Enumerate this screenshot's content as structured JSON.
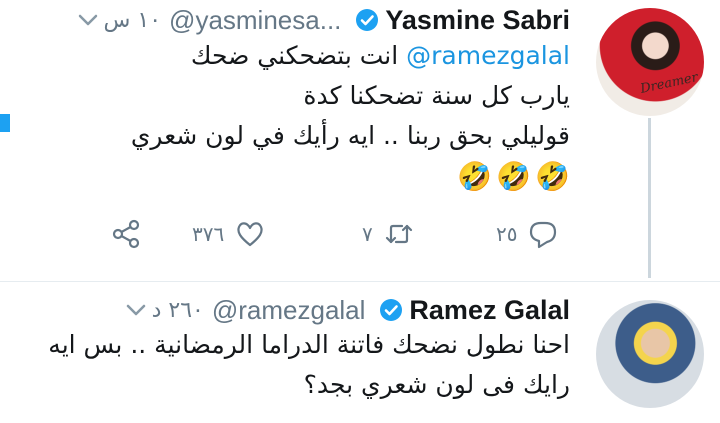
{
  "tweets": [
    {
      "name": "Yasmine Sabri",
      "handle": "@yasminesa...",
      "time": "١٠ س",
      "lines": [
        "@ramezgalal انت بتضحكني ضحك",
        "يارب كل سنة تضحكنا كدة",
        "قوليلي بحق ربنا .. ايه رأيك في لون شعري"
      ],
      "mention": "@ramezgalal",
      "line1_rest": "انت بتضحكني ضحك",
      "emojis": [
        "🤣",
        "🤣",
        "🤣"
      ],
      "avatar_text": "Dreamer",
      "actions": {
        "reply_count": "٢٥",
        "retweet_count": "٧",
        "like_count": "٣٧٦"
      }
    },
    {
      "name": "Ramez Galal",
      "handle": "@ramezgalal",
      "time": "٢٦٠ د",
      "lines": [
        "احنا نطول نضحك فاتنة الدراما الرمضانية .. بس ايه",
        "رايك فى لون شعري بجد؟"
      ]
    }
  ],
  "colors": {
    "accent": "#1b95e0",
    "verified": "#1da1f2",
    "secondary_text": "#657786",
    "divider": "#e6ecf0"
  },
  "icons": [
    "chevron-down-icon",
    "verified-badge-icon",
    "share-icon",
    "heart-icon",
    "retweet-icon",
    "reply-icon"
  ]
}
